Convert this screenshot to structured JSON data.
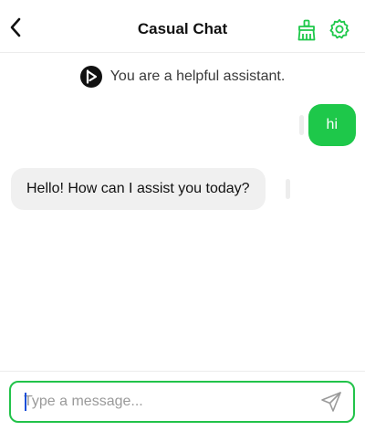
{
  "header": {
    "title": "Casual Chat",
    "back_icon": "chevron-left-icon",
    "clean_icon": "broom-icon",
    "settings_icon": "gear-icon",
    "accent_color": "#1ec84a"
  },
  "system_prompt": {
    "avatar_icon": "play-logo-icon",
    "text": "You are a helpful assistant."
  },
  "messages": [
    {
      "role": "user",
      "text": "hi"
    },
    {
      "role": "assistant",
      "text": "Hello! How can I assist you today?"
    }
  ],
  "composer": {
    "placeholder": "Type a message...",
    "value": "",
    "send_icon": "send-icon",
    "border_color": "#22c34a"
  }
}
